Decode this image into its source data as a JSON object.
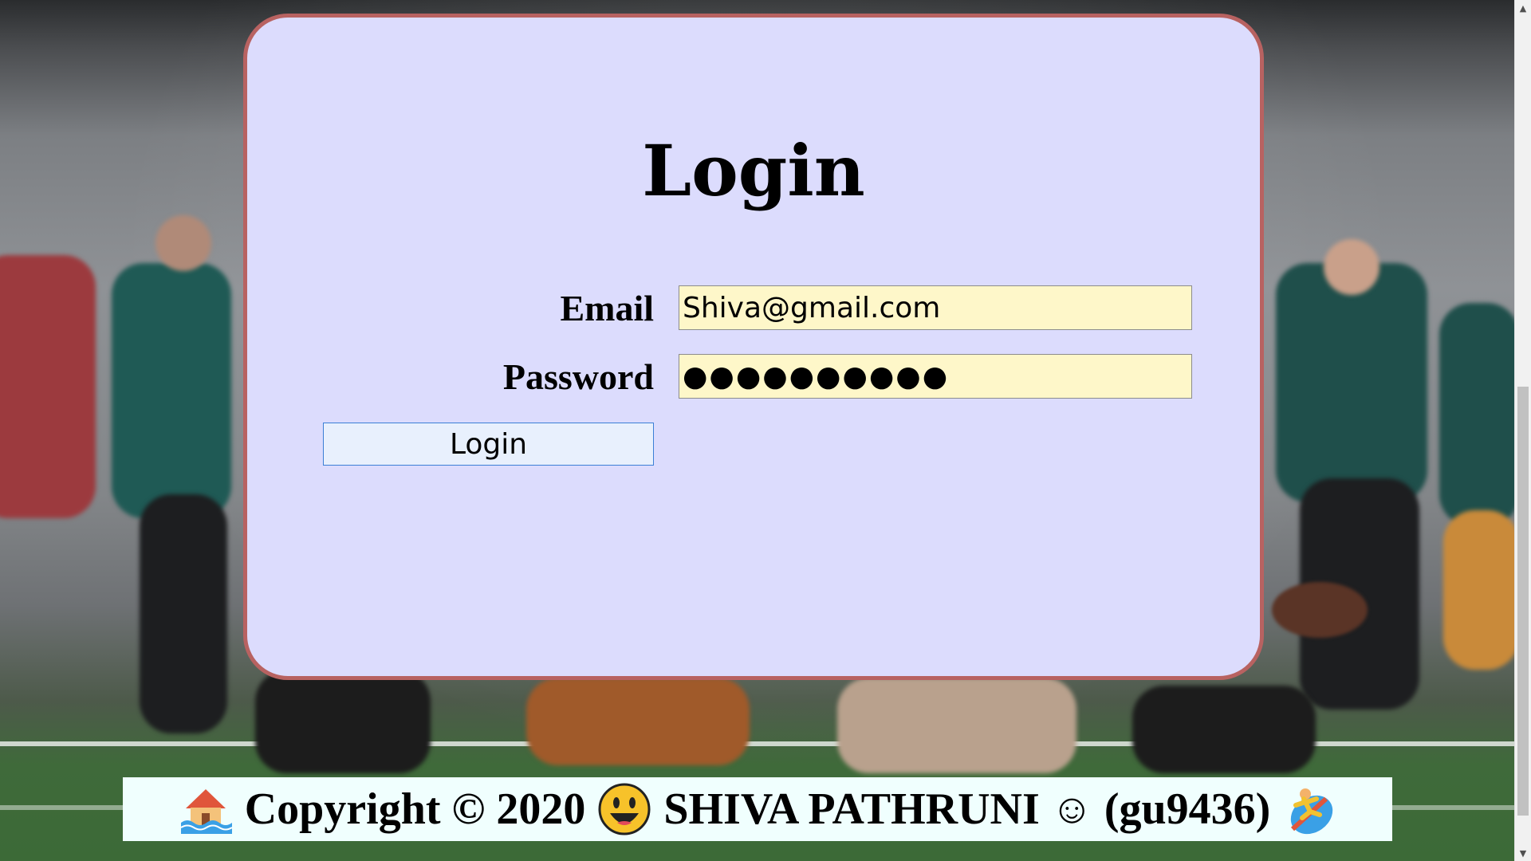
{
  "login": {
    "title": "Login",
    "email_label": "Email",
    "email_value": "Shiva@gmail.com",
    "password_label": "Password",
    "password_value": "●●●●●●●●●●",
    "submit_label": "Login"
  },
  "footer": {
    "copyright": "Copyright © 2020",
    "name": "SHIVA PATHRUNI",
    "smile": "☺",
    "handle": "(gu9436)",
    "icons": [
      "house-flood-icon",
      "grinning-face-icon",
      "surfer-icon"
    ]
  },
  "colors": {
    "card_background": "#dcdcfd",
    "card_border": "#b86261",
    "input_background": "#fef7c9",
    "button_background": "#e8f0fd",
    "button_border": "#3b7fd6",
    "footer_background": "#f0fffe"
  }
}
